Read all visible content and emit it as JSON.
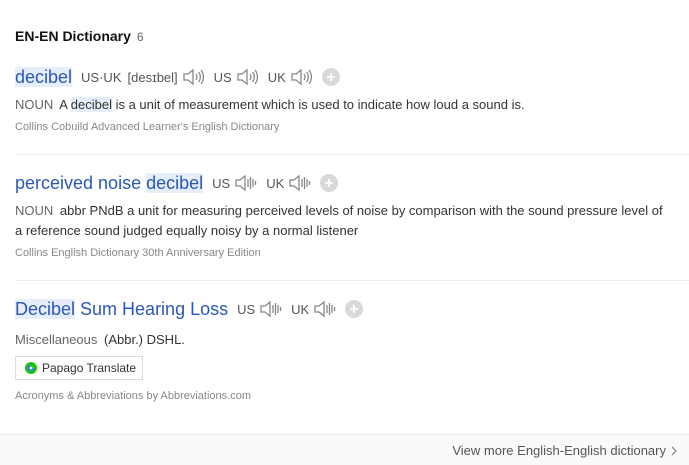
{
  "section": {
    "title": "EN-EN Dictionary",
    "count": "6"
  },
  "entries": [
    {
      "word_hl": "decibel",
      "word_rest": "",
      "pron_region": "US·UK",
      "ipa": "[desɪbel]",
      "pron_us": "US",
      "pron_uk": "UK",
      "pos": "NOUN",
      "def_pre": "A ",
      "def_hl": "decibel",
      "def_post": " is a unit of measurement which is used to indicate how loud a sound is.",
      "source": "Collins Cobuild Advanced Learner's English Dictionary"
    },
    {
      "word_pre": "perceived noise ",
      "word_hl": "decibel",
      "pron_us": "US",
      "pron_uk": "UK",
      "pos": "NOUN",
      "def": "abbr PNdB a unit for measuring perceived levels of noise by comparison with the sound pressure level of a reference sound judged equally noisy by a normal listener",
      "source": "Collins English Dictionary 30th Anniversary Edition"
    },
    {
      "word_hl": "Decibel",
      "word_rest": " Sum Hearing Loss",
      "pron_us": "US",
      "pron_uk": "UK",
      "pos": "Miscellaneous",
      "def": "(Abbr.) DSHL.",
      "source": "Acronyms & Abbreviations by Abbreviations.com"
    }
  ],
  "papago": {
    "label": "Papago Translate"
  },
  "footer": {
    "more_label": "View more English-English dictionary"
  },
  "colors": {
    "link": "#2b58b8",
    "highlight": "#e6eefc",
    "papago_green": "#1ec800",
    "papago_blue": "#2f7df6"
  },
  "icons": {
    "speaker": "speaker-icon",
    "add": "plus-circle-icon",
    "chevron": "chevron-right-icon"
  }
}
